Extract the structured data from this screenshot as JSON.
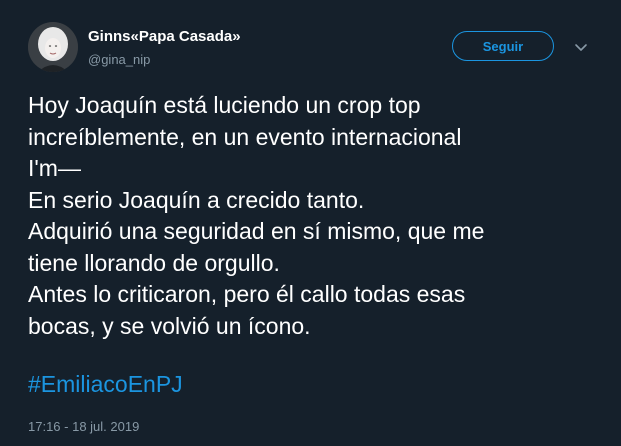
{
  "user": {
    "display_name": "Ginns«Papa Casada»",
    "username": "@gina_nip",
    "avatar_icon": "profile-photo"
  },
  "actions": {
    "follow_label": "Seguir",
    "menu_icon": "chevron-down-icon"
  },
  "tweet": {
    "lines": [
      "Hoy Joaquín está luciendo un crop top",
      "increíblemente, en un evento internacional",
      "I'm—",
      "En serio Joaquín a crecido tanto.",
      "Adquirió una seguridad en sí mismo, que me",
      "tiene llorando de orgullo.",
      "Antes lo criticaron, pero él callo todas esas",
      "bocas, y se volvió un ícono."
    ],
    "hashtag": "#EmiliacoEnPJ",
    "timestamp": "17:16 - 18 jul. 2019"
  },
  "colors": {
    "background": "#15202b",
    "text": "#ffffff",
    "secondary": "#8899a6",
    "accent": "#1b95e0"
  }
}
